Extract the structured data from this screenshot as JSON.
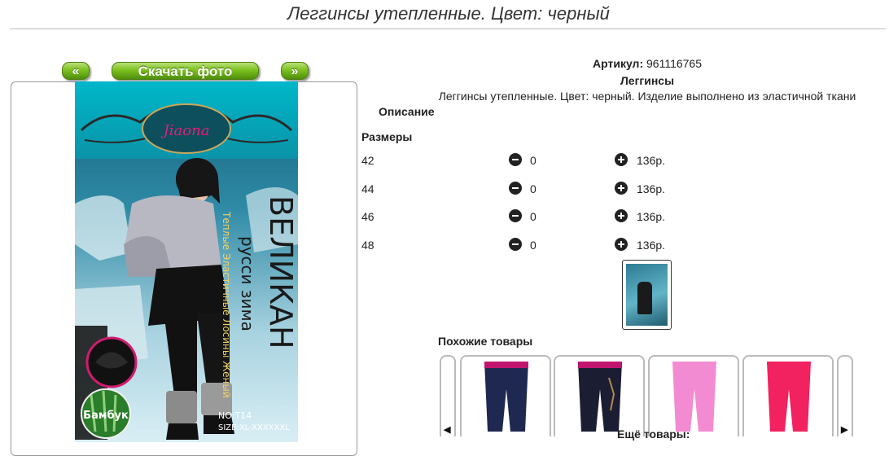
{
  "page": {
    "title": "Леггинсы утепленные. Цвет: черный"
  },
  "gallery": {
    "prev_label": "«",
    "download_label": "Скачать фото",
    "next_label": "»",
    "product_image": {
      "brand": "Jiaona",
      "big_title": "ВЕЛИКАН",
      "subtitle": "русси зима",
      "vertical_text": "Теплые Эластичные Лосины Женый",
      "badge": "Бамбук",
      "model_no": "NO:T14",
      "size": "SIZE:XL-XXXXXXL"
    }
  },
  "product": {
    "article_label": "Артикул:",
    "article_value": "961116765",
    "category": "Леггинсы",
    "description": "Леггинсы утепленные. Цвет: черный. Изделие выполнено из эластичной ткани",
    "description_label": "Описание",
    "sizes_label": "Размеры",
    "sizes": [
      {
        "size": "42",
        "qty": "0",
        "price": "136р."
      },
      {
        "size": "44",
        "qty": "0",
        "price": "136р."
      },
      {
        "size": "46",
        "qty": "0",
        "price": "136р."
      },
      {
        "size": "48",
        "qty": "0",
        "price": "136р."
      }
    ]
  },
  "similar": {
    "label": "Похожие товары",
    "prev_icon": "◀",
    "next_icon": "▶",
    "items": [
      {
        "color": "#1f2850"
      },
      {
        "color": "#1b1d33"
      },
      {
        "color": "#f38bd2"
      },
      {
        "color": "#f2215f"
      }
    ]
  },
  "more_label": "Ещё товары:"
}
